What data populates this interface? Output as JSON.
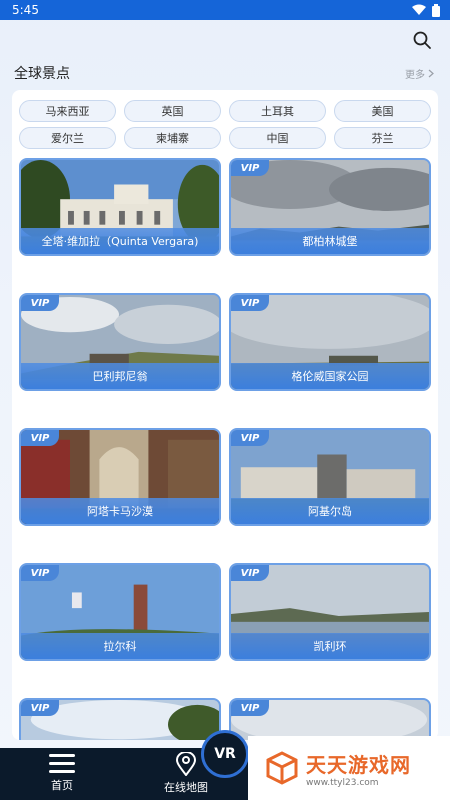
{
  "status_bar": {
    "time": "5:45"
  },
  "header": {
    "section_title": "全球景点",
    "more_label": "更多"
  },
  "tags": [
    "马来西亚",
    "英国",
    "土耳其",
    "美国",
    "爱尔兰",
    "柬埔寨",
    "中国",
    "芬兰"
  ],
  "vip_label": "VIP",
  "cards": [
    {
      "label": "全塔·维加拉（Quinta Vergara)",
      "vip": false,
      "scene": "villa"
    },
    {
      "label": "都柏林城堡",
      "vip": true,
      "scene": "lake"
    },
    {
      "label": "巴利邦尼翁",
      "vip": true,
      "scene": "ruins"
    },
    {
      "label": "格伦威国家公园",
      "vip": true,
      "scene": "moor"
    },
    {
      "label": "阿塔卡马沙漠",
      "vip": true,
      "scene": "cathedral"
    },
    {
      "label": "阿基尔岛",
      "vip": true,
      "scene": "castle"
    },
    {
      "label": "拉尔科",
      "vip": true,
      "scene": "tower"
    },
    {
      "label": "凯利环",
      "vip": true,
      "scene": "coast"
    },
    {
      "label": "",
      "vip": true,
      "scene": "sky"
    },
    {
      "label": "",
      "vip": true,
      "scene": "sky"
    }
  ],
  "nav": {
    "home_label": "首页",
    "map_label": "在线地图",
    "vr_label": "VR"
  },
  "watermark": {
    "name": "天天游戏网",
    "url": "www.ttyl23.com"
  },
  "colors": {
    "accent": "#1565d8",
    "card_border": "#6da0e6",
    "label_bg": "#3c7fdd",
    "nav_bg": "#0b1a2b",
    "watermark": "#e8682a"
  }
}
